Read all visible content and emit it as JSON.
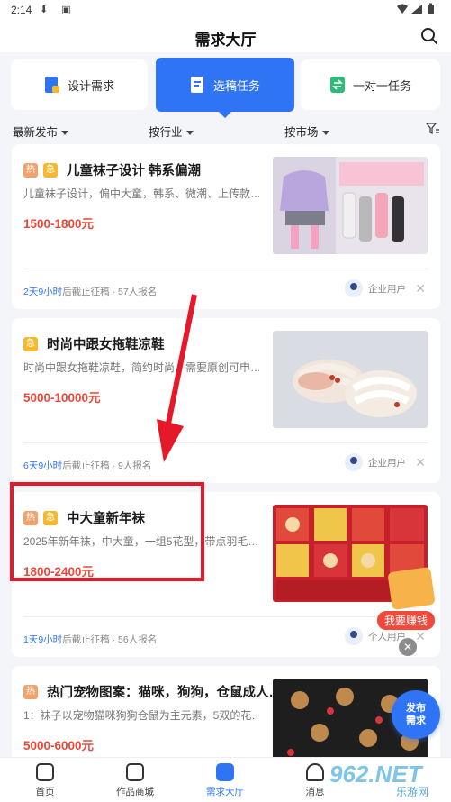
{
  "status_bar": {
    "time": "2:14"
  },
  "header": {
    "title": "需求大厅"
  },
  "tabs": [
    {
      "label": "设计需求"
    },
    {
      "label": "选稿任务"
    },
    {
      "label": "一对一任务"
    }
  ],
  "filters": [
    {
      "label": "最新发布"
    },
    {
      "label": "按行业"
    },
    {
      "label": "按市场"
    }
  ],
  "cards": [
    {
      "tags": [
        "热",
        "急"
      ],
      "title": "儿童袜子设计 韩系偏潮",
      "desc": "儿童袜子设计，偏中大童，韩系、微潮、上传款…",
      "price": "1500-1800元",
      "deadline": "2天9小时",
      "deadline_suffix": "后截止征稿 · 57人报名",
      "user": "企业用户"
    },
    {
      "tags": [
        "急"
      ],
      "title": "时尚中跟女拖鞋凉鞋",
      "desc": "时尚中跟女拖鞋凉鞋，简约时尚，需要原创可申…",
      "price": "5000-10000元",
      "deadline": "6天9小时",
      "deadline_suffix": "后截止征稿 · 9人报名",
      "user": "企业用户"
    },
    {
      "tags": [
        "热",
        "急"
      ],
      "title": "中大童新年袜",
      "desc": "2025年新年袜，中大童，一组5花型，带点羽毛…",
      "price": "1800-2400元",
      "deadline": "1天9小时",
      "deadline_suffix": "后截止征稿 · 56人报名",
      "user": "个人用户"
    },
    {
      "tags": [
        "热"
      ],
      "title": "热门宠物图案：猫咪，狗狗，仓鼠成人…",
      "desc": "1：袜子以宠物猫咪狗狗仓鼠为主元素，5双的花…",
      "price": "5000-6000元"
    }
  ],
  "promo": {
    "label": "我要赚钱"
  },
  "fab": {
    "line1": "发布",
    "line2": "需求"
  },
  "bottom_nav": [
    {
      "label": "首页"
    },
    {
      "label": "作品商城"
    },
    {
      "label": "需求大厅"
    },
    {
      "label": "消息"
    }
  ],
  "watermark": {
    "text": "962.NET",
    "sub": "乐游网"
  },
  "colors": {
    "accent": "#2f74f5",
    "price": "#e84a3a",
    "hot_tag": "#f2a36c",
    "urgent_tag": "#f5b82e",
    "annotation": "#e5192a"
  }
}
